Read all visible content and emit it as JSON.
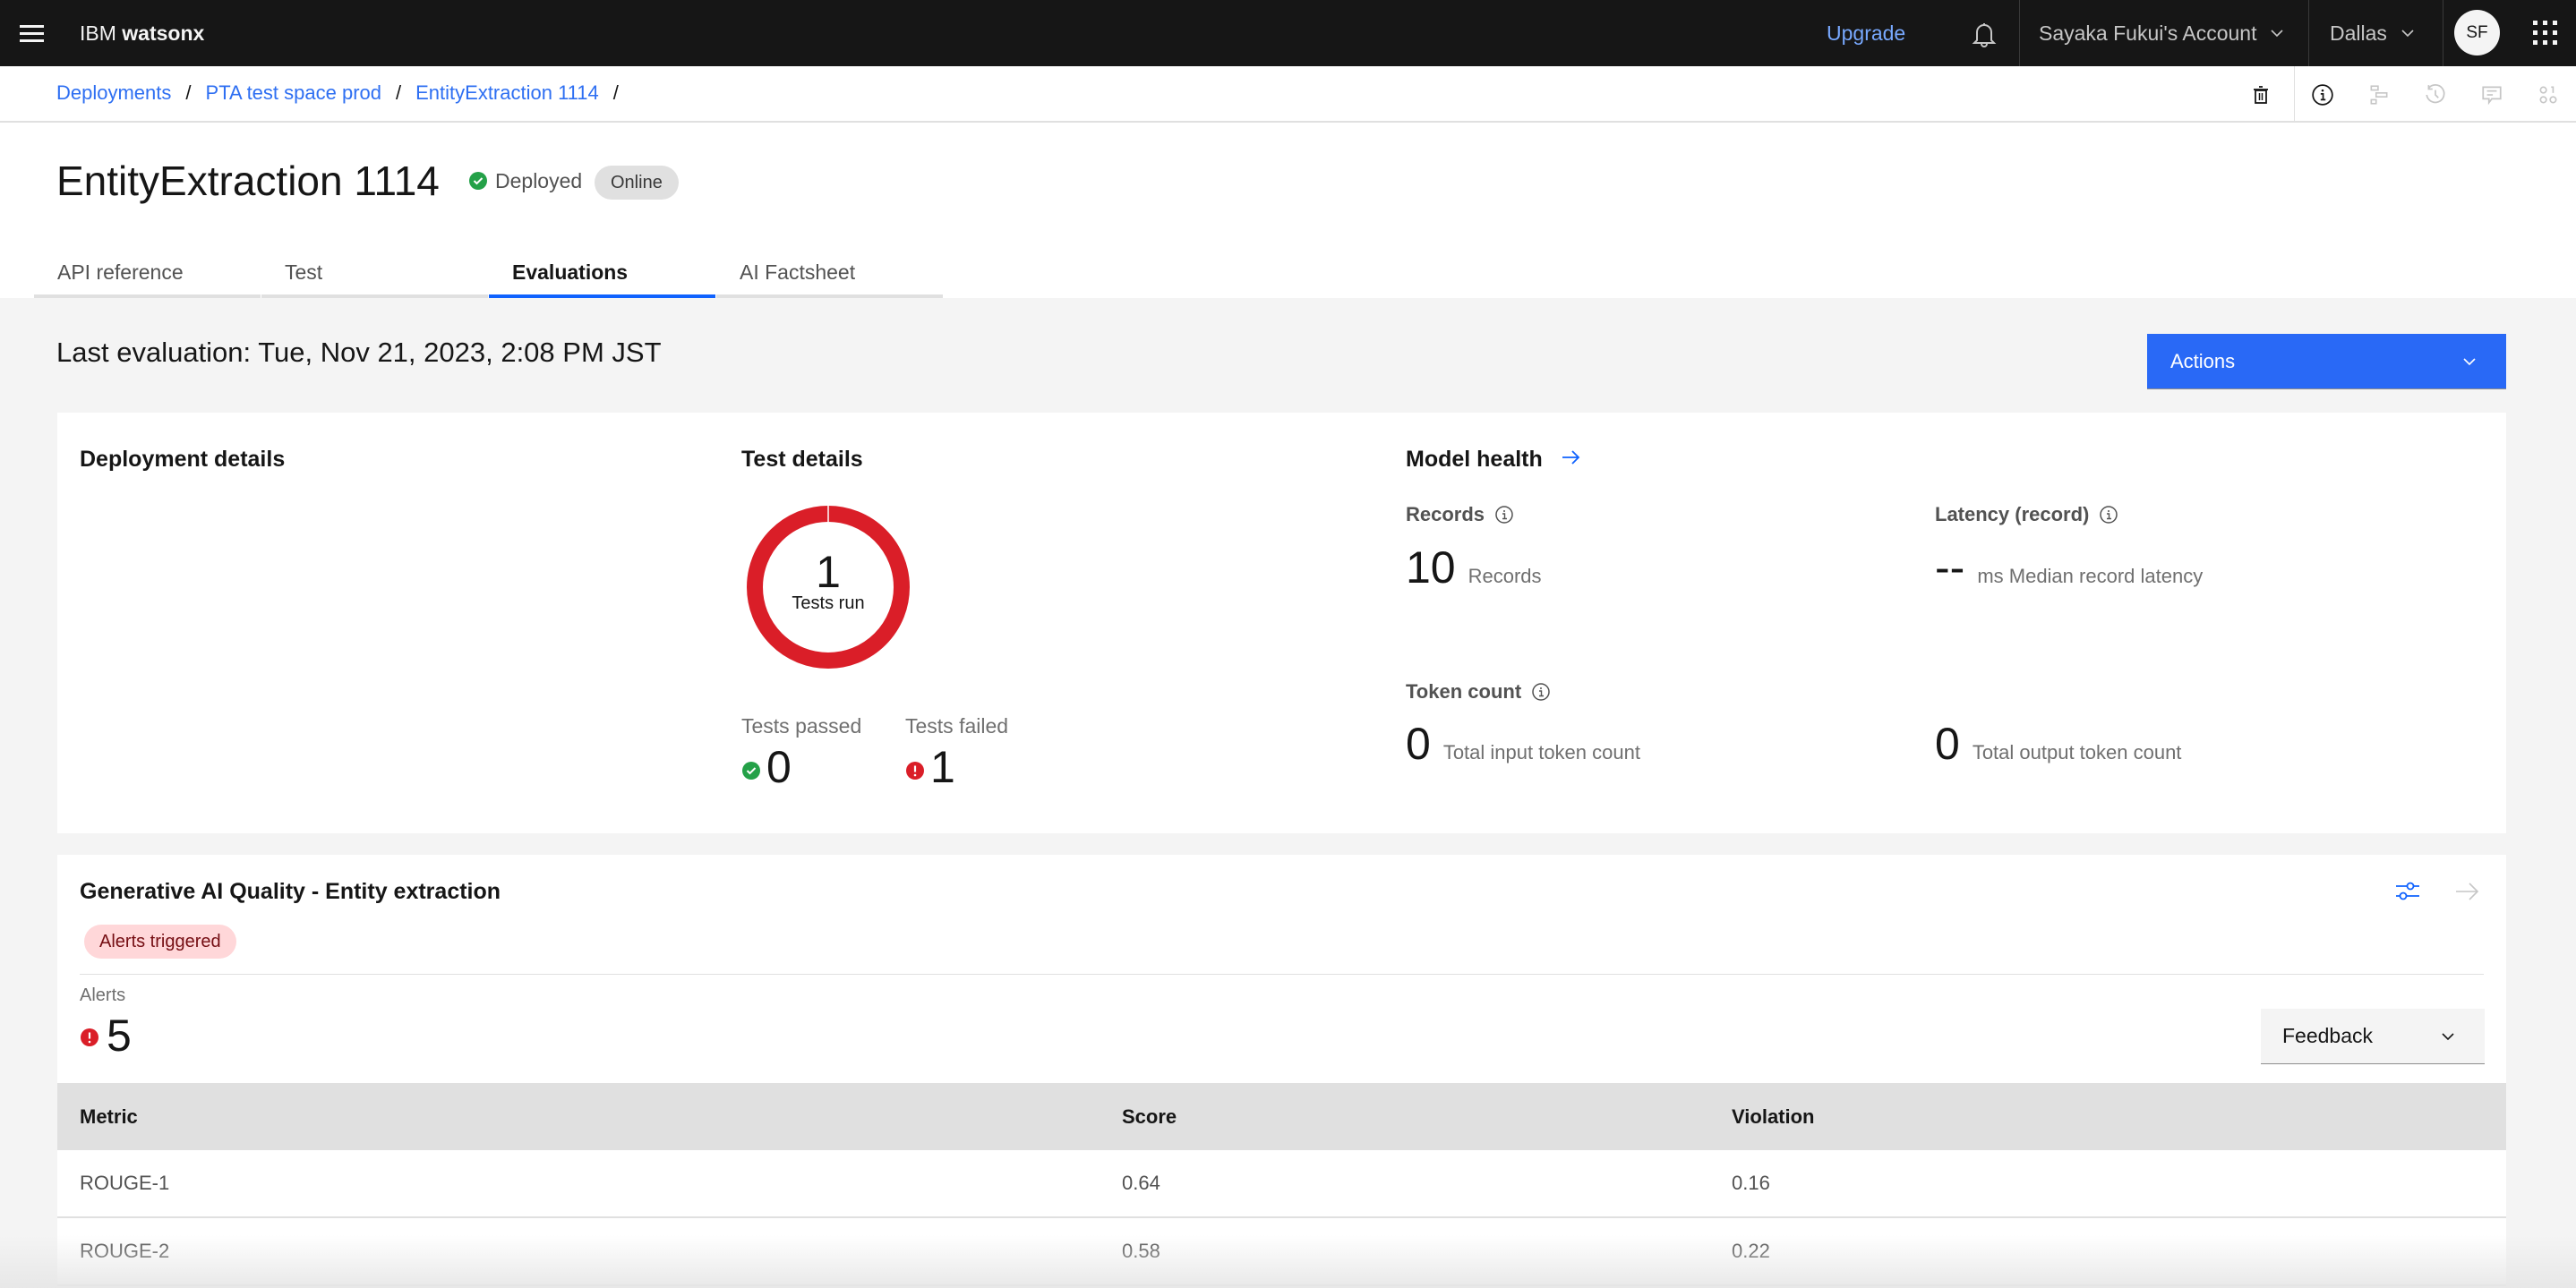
{
  "topnav": {
    "brand_prefix": "IBM",
    "brand_name": "watsonx",
    "upgrade_label": "Upgrade",
    "account_label": "Sayaka Fukui's Account",
    "region_label": "Dallas",
    "avatar_initials": "SF"
  },
  "breadcrumb": {
    "items": [
      "Deployments",
      "PTA test space prod",
      "EntityExtraction 1114"
    ],
    "separator": "/"
  },
  "header": {
    "title": "EntityExtraction 1114",
    "status": "Deployed",
    "tag": "Online",
    "status_color": "#24a148"
  },
  "tabs": [
    {
      "label": "API reference",
      "active": false
    },
    {
      "label": "Test",
      "active": false
    },
    {
      "label": "Evaluations",
      "active": true
    },
    {
      "label": "AI Factsheet",
      "active": false
    }
  ],
  "evaluation": {
    "last_evaluation": "Last evaluation: Tue, Nov 21, 2023, 2:08 PM JST",
    "actions_label": "Actions"
  },
  "deployment_details": {
    "title": "Deployment details"
  },
  "test_details": {
    "title": "Test details",
    "tests_run": "1",
    "tests_run_label": "Tests run",
    "tests_passed_label": "Tests passed",
    "tests_passed": "0",
    "tests_failed_label": "Tests failed",
    "tests_failed": "1",
    "passed_fraction": 0,
    "failed_fraction": 1,
    "failed_color": "#da1e28",
    "passed_color": "#24a148"
  },
  "model_health": {
    "title": "Model health",
    "records_label": "Records",
    "records_value": "10",
    "records_unit": "Records",
    "latency_label": "Latency (record)",
    "latency_value": "--",
    "latency_unit": "ms Median record latency",
    "token_label": "Token count",
    "input_tokens": "0",
    "input_tokens_unit": "Total input token count",
    "output_tokens": "0",
    "output_tokens_unit": "Total output token count"
  },
  "quality": {
    "title": "Generative AI Quality - Entity extraction",
    "alert_tag": "Alerts triggered",
    "alerts_label": "Alerts",
    "alerts_count": "5",
    "feedback_label": "Feedback",
    "columns": [
      "Metric",
      "Score",
      "Violation"
    ],
    "rows": [
      {
        "metric": "ROUGE-1",
        "score": "0.64",
        "violation": "0.16"
      },
      {
        "metric": "ROUGE-2",
        "score": "0.58",
        "violation": "0.22"
      }
    ]
  }
}
